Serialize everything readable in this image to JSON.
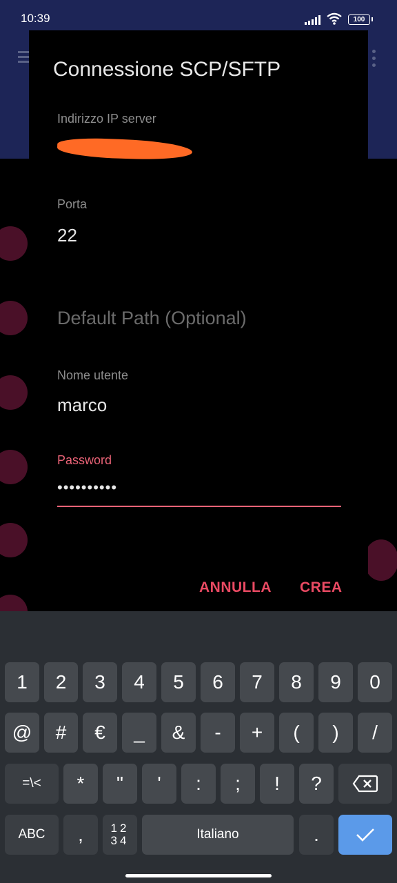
{
  "status_bar": {
    "time": "10:39",
    "battery": "100"
  },
  "dialog": {
    "title": "Connessione SCP/SFTP",
    "server_ip": {
      "label": "Indirizzo IP server",
      "value": ""
    },
    "port": {
      "label": "Porta",
      "value": "22"
    },
    "default_path": {
      "placeholder": "Default Path (Optional)"
    },
    "username": {
      "label": "Nome utente",
      "value": "marco"
    },
    "password": {
      "label": "Password",
      "value": "••••••••••"
    },
    "cancel_label": "ANNULLA",
    "create_label": "CREA"
  },
  "keyboard": {
    "row1": [
      "1",
      "2",
      "3",
      "4",
      "5",
      "6",
      "7",
      "8",
      "9",
      "0"
    ],
    "row2": [
      "@",
      "#",
      "€",
      "_",
      "&",
      "-",
      "+",
      "(",
      ")",
      "/"
    ],
    "row3": [
      "=\\<",
      "*",
      "\"",
      "'",
      ":",
      ";",
      "!",
      "?"
    ],
    "abc": "ABC",
    "comma": ",",
    "numpad_top": "12",
    "numpad_bottom": "34",
    "space": "Italiano",
    "period": "."
  },
  "colors": {
    "accent": "#ea4a63",
    "header": "#1d2557",
    "enter_key": "#5b9ae9",
    "redaction": "#ff6a25"
  }
}
